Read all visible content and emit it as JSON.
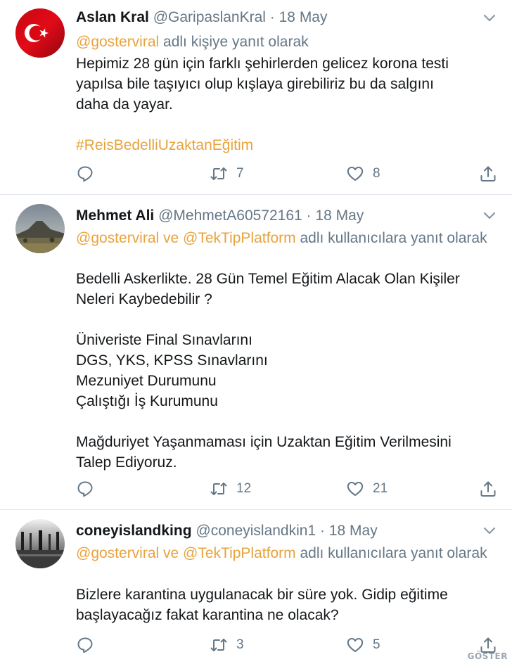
{
  "tweets": [
    {
      "name": "Aslan Kral",
      "handle": "@GaripaslanKral",
      "separator": "·",
      "date": "18 May",
      "reply_mentions": "@gosterviral",
      "reply_suffix": " adlı kişiye yanıt olarak",
      "lines": [
        "Hepimiz 28 gün için farklı şehirlerden gelicez korona testi",
        "yapılsa bile taşıyıcı olup kışlaya girebiliriz bu da salgını",
        "daha da yayar."
      ],
      "hashtag": "#ReisBedelliUzaktanEğitim",
      "retweets": "7",
      "likes": "8"
    },
    {
      "name": "Mehmet Ali",
      "handle": "@MehmetA60572161",
      "separator": "·",
      "date": "18 May",
      "reply_mentions": "@gosterviral ve @TekTipPlatform",
      "reply_suffix": " adlı kullanıcılara yanıt olarak",
      "lines": [
        "Bedelli Askerlikte. 28 Gün Temel Eğitim Alacak Olan Kişiler",
        "Neleri Kaybedebilir ?",
        "",
        "Üniveriste Final Sınavlarını",
        "DGS, YKS, KPSS Sınavlarını",
        "Mezuniyet Durumunu",
        "Çalıştığı İş Kurumunu",
        "",
        "Mağduriyet Yaşanmaması için Uzaktan Eğitim Verilmesini",
        "Talep Ediyoruz."
      ],
      "retweets": "12",
      "likes": "21"
    },
    {
      "name": "coneyislandking",
      "handle": "@coneyislandkin1",
      "separator": "·",
      "date": "18 May",
      "reply_mentions": "@gosterviral ve @TekTipPlatform",
      "reply_suffix": " adlı kullanıcılara yanıt olarak",
      "lines": [
        "Bizlere karantina uygulanacak bir süre yok. Gidip eğitime",
        "başlayacağız fakat karantina ne olacak?"
      ],
      "retweets": "3",
      "likes": "5"
    }
  ],
  "watermark": "GÖSTER",
  "colors": {
    "accent": "#e8a33c",
    "secondary_text": "#657786",
    "divider": "#e1e8ed",
    "flag_red": "#e30a17"
  },
  "icons": [
    "caret-down-icon",
    "reply-icon",
    "retweet-icon",
    "like-icon",
    "share-icon"
  ]
}
